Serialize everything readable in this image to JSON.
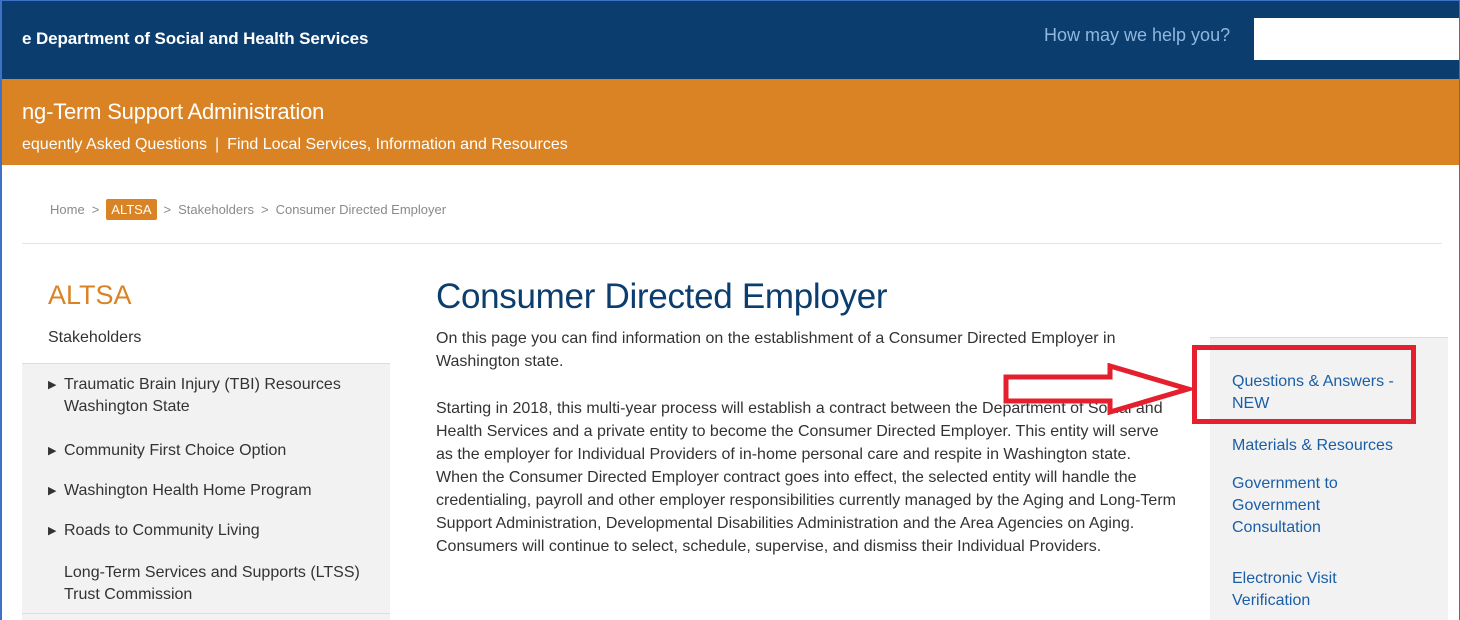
{
  "header": {
    "agency_name": "e Department of Social and Health Services",
    "search_label": "How may we help you?",
    "search_value": ""
  },
  "admin_bar": {
    "title": "ng-Term Support Administration",
    "links": [
      {
        "label": "equently Asked Questions"
      },
      {
        "label": "Find Local Services, Information and Resources"
      }
    ],
    "separator": "|"
  },
  "breadcrumb": {
    "items": [
      "Home",
      "ALTSA",
      "Stakeholders",
      "Consumer Directed Employer"
    ],
    "separator": ">"
  },
  "sidebar": {
    "title": "ALTSA",
    "section": "Stakeholders",
    "items": [
      {
        "label": "Traumatic Brain Injury (TBI) Resources Washington State",
        "expandable": true
      },
      {
        "label": "Community First Choice Option",
        "expandable": true
      },
      {
        "label": "Washington Health Home Program",
        "expandable": true
      },
      {
        "label": "Roads to Community Living",
        "expandable": true
      },
      {
        "label": "Long-Term Services and Supports (LTSS) Trust Commission",
        "expandable": false
      }
    ]
  },
  "main": {
    "title": "Consumer Directed Employer",
    "paragraphs": [
      "On this page you can find information on the establishment of a Consumer Directed Employer in Washington state.",
      "Starting in 2018, this multi-year process will establish a contract between the Department of Social and Health Services and a private entity to become the Consumer Directed Employer. This entity will serve as the employer for Individual Providers of in-home personal care and respite in Washington state.  When the Consumer Directed Employer contract goes into effect, the selected entity will handle the credentialing, payroll and other employer responsibilities currently managed by the Aging and Long-Term Support Administration, Developmental Disabilities Administration and the Area Agencies on Aging. Consumers will continue to select, schedule, supervise, and dismiss their Individual Providers."
    ]
  },
  "right_sidebar": {
    "links": [
      {
        "label": "Questions & Answers - NEW"
      },
      {
        "label": "Materials & Resources"
      },
      {
        "label": "Government to Government Consultation"
      },
      {
        "label": "Electronic Visit Verification"
      }
    ]
  },
  "colors": {
    "header_blue": "#0b3d6e",
    "admin_orange": "#d98324",
    "link_blue": "#1a5ea8",
    "annotation_red": "#e5202e"
  },
  "icons": {
    "expand": "triangle-right-icon",
    "annotation": "red-arrow-icon"
  }
}
